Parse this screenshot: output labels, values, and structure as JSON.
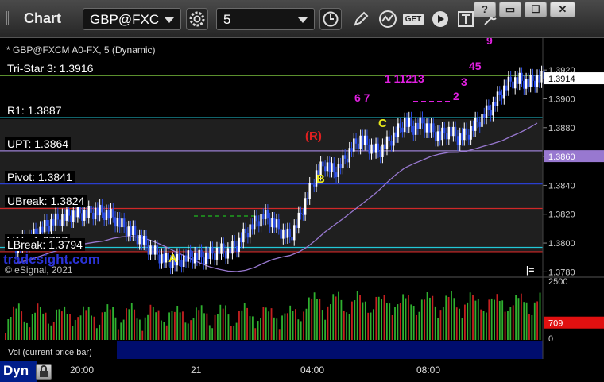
{
  "window": {
    "title": "Chart",
    "controls": {
      "help": "?",
      "restore": "▭",
      "maximize": "☐",
      "close": "✕"
    }
  },
  "toolbar": {
    "symbol": "GBP@FXC",
    "interval": "5",
    "get_label": "GET",
    "icons": [
      "settings-icon",
      "clock-icon",
      "pencil-icon",
      "study-icon",
      "get-icon",
      "play-icon",
      "text-icon",
      "tools-icon"
    ]
  },
  "chart_header": "* GBP@FXCM A0-FX, 5 (Dynamic)",
  "level_labels": [
    {
      "text": "Tri-Star 3: 1.3916",
      "price": 1.3916,
      "color": "#5b8f2e"
    },
    {
      "text": "R1: 1.3887",
      "price": 1.3887,
      "color": "#22c8d8"
    },
    {
      "text": "UPT: 1.3864",
      "price": 1.3864,
      "color": "#9a7fd0"
    },
    {
      "text": "Pivot: 1.3841",
      "price": 1.3841,
      "color": "#2a3fd0"
    },
    {
      "text": "UBreak: 1.3824",
      "price": 1.3824,
      "color": "#d02828"
    },
    {
      "text": "VAL: 1.3797",
      "price": 1.3797,
      "color": "#22c8d8"
    },
    {
      "text": "LBreak: 1.3794",
      "price": 1.3794,
      "color": "#d02828"
    }
  ],
  "hidden_label_fragments": [
    "5",
    "94",
    "04: 4.3773"
  ],
  "watermark": {
    "brand": "tradesight.com",
    "copyright": "© eSignal, 2021"
  },
  "markers": {
    "A": "A",
    "B": "B",
    "C": "C",
    "R_box": "(R)",
    "eq": "|="
  },
  "volume": {
    "label": "Vol (current price bar)",
    "axis_top": "2500",
    "axis_bottom": "0",
    "current": "709",
    "current_color": "#e01010"
  },
  "x_axis": {
    "labels": [
      "20:00",
      "21",
      "04:00",
      "08:00"
    ]
  },
  "footer": {
    "mode": "Dyn"
  },
  "chart_data": {
    "type": "candlestick",
    "instrument": "GBP@FXCM A0-FX",
    "interval": "5",
    "y_ticks": [
      1.378,
      1.38,
      1.382,
      1.384,
      1.386,
      1.388,
      1.39,
      1.392
    ],
    "ylim": [
      1.3778,
      1.393
    ],
    "last_price": 1.3914,
    "last_price_label": "1.3914",
    "ma_value": 1.386,
    "ma_value_label": "1.3860",
    "ma_color": "#9878d0",
    "close_path": [
      1.3798,
      1.3801,
      1.3805,
      1.381,
      1.3814,
      1.3817,
      1.3819,
      1.3821,
      1.382,
      1.3822,
      1.3821,
      1.3818,
      1.3812,
      1.3808,
      1.3803,
      1.3797,
      1.3792,
      1.3788,
      1.3787,
      1.3789,
      1.3791,
      1.379,
      1.3792,
      1.3795,
      1.3794,
      1.3799,
      1.3807,
      1.3814,
      1.3819,
      1.3815,
      1.3808,
      1.3804,
      1.3816,
      1.3833,
      1.3848,
      1.3855,
      1.3849,
      1.3856,
      1.3866,
      1.3872,
      1.3867,
      1.3863,
      1.3869,
      1.3876,
      1.3884,
      1.388,
      1.3883,
      1.3878,
      1.3874,
      1.3878,
      1.3873,
      1.3875,
      1.3882,
      1.3889,
      1.3895,
      1.3905,
      1.3912,
      1.3913,
      1.3911,
      1.3914
    ]
  }
}
